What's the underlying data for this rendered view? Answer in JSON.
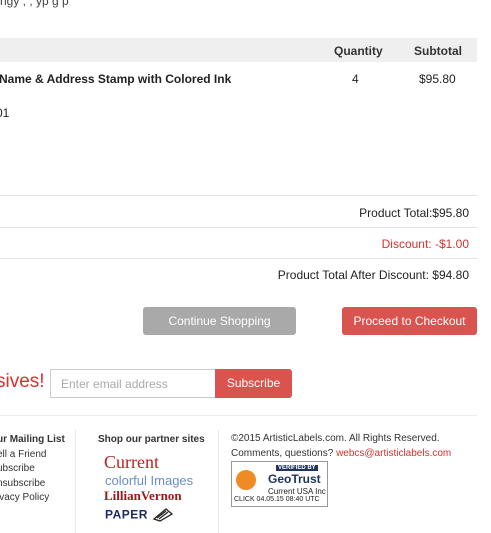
{
  "cutoff_top_text": "ngy                                                                         ,  ,   yp  g  p",
  "cart": {
    "headers": {
      "quantity": "Quantity",
      "subtotal": "Subtotal"
    },
    "item": {
      "name": "Name & Address Stamp with Colored Ink",
      "quantity": "4",
      "subtotal": "$95.80",
      "sku": "01"
    },
    "totals": {
      "product_total": "Product Total:$95.80",
      "discount": "Discount: -$1.00",
      "after_discount": "Product Total After Discount: $94.80"
    }
  },
  "actions": {
    "continue_label": "Continue Shopping",
    "checkout_label": "Proceed to Checkout"
  },
  "newsletter": {
    "promo_text": "sives!",
    "email_placeholder": "Enter email address",
    "subscribe_label": "Subscribe"
  },
  "footer": {
    "mailing": {
      "heading": "ur Mailing List",
      "links": [
        "ell a Friend",
        "ubscribe",
        "nsubscribe",
        "ivacy Policy"
      ]
    },
    "partners": {
      "heading": "Shop our partner sites",
      "sites": [
        "Current",
        "colorful Images",
        "LillianVernon",
        "PAPER"
      ]
    },
    "legal": {
      "copyright": "©2015 ArtisticLabels.com. All Rights Reserved.",
      "questions": "Comments, questions?",
      "email": "webcs@artisticlabels.com"
    },
    "geotrust": {
      "verified": "VERIFIED BY",
      "brand": "GeoTrust",
      "org": "Current USA Inc",
      "click_date": "CLICK 04.05.15 08:40 UTC"
    }
  },
  "colors": {
    "accent_red": "#d9534f",
    "grey_button": "#a9a9a9",
    "link_red": "#d9302c"
  }
}
